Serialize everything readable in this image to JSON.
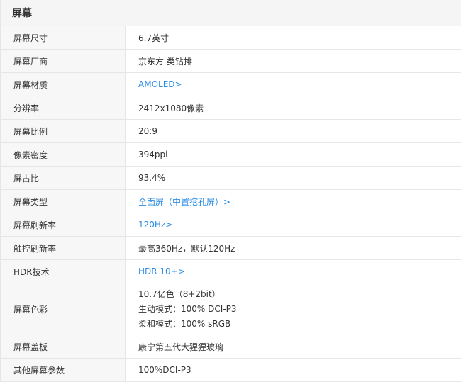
{
  "section_title": "屏幕",
  "rows": [
    {
      "label": "屏幕尺寸",
      "value": "6.7英寸"
    },
    {
      "label": "屏幕厂商",
      "value": "京东方 类钻排"
    },
    {
      "label": "屏幕材质",
      "value": "AMOLED>"
    },
    {
      "label": "分辨率",
      "value": "2412x1080像素"
    },
    {
      "label": "屏幕比例",
      "value": "20:9"
    },
    {
      "label": "像素密度",
      "value": "394ppi"
    },
    {
      "label": "屏占比",
      "value": "93.4%"
    },
    {
      "label": "屏幕类型",
      "value": "全面屏（中置挖孔屏）>"
    },
    {
      "label": "屏幕刷新率",
      "value": "120Hz>"
    },
    {
      "label": "触控刷新率",
      "value": "最高360Hz，默认120Hz"
    },
    {
      "label": "HDR技术",
      "value": "HDR 10+>"
    },
    {
      "label": "屏幕色彩",
      "lines": [
        "10.7亿色（8+2bit）",
        "生动模式：100% DCI-P3",
        "柔和模式：100% sRGB"
      ]
    },
    {
      "label": "屏幕盖板",
      "value": "康宁第五代大猩猩玻璃"
    },
    {
      "label": "其他屏幕参数",
      "value": "100%DCI-P3"
    }
  ],
  "link_color": "#2b8ce6"
}
